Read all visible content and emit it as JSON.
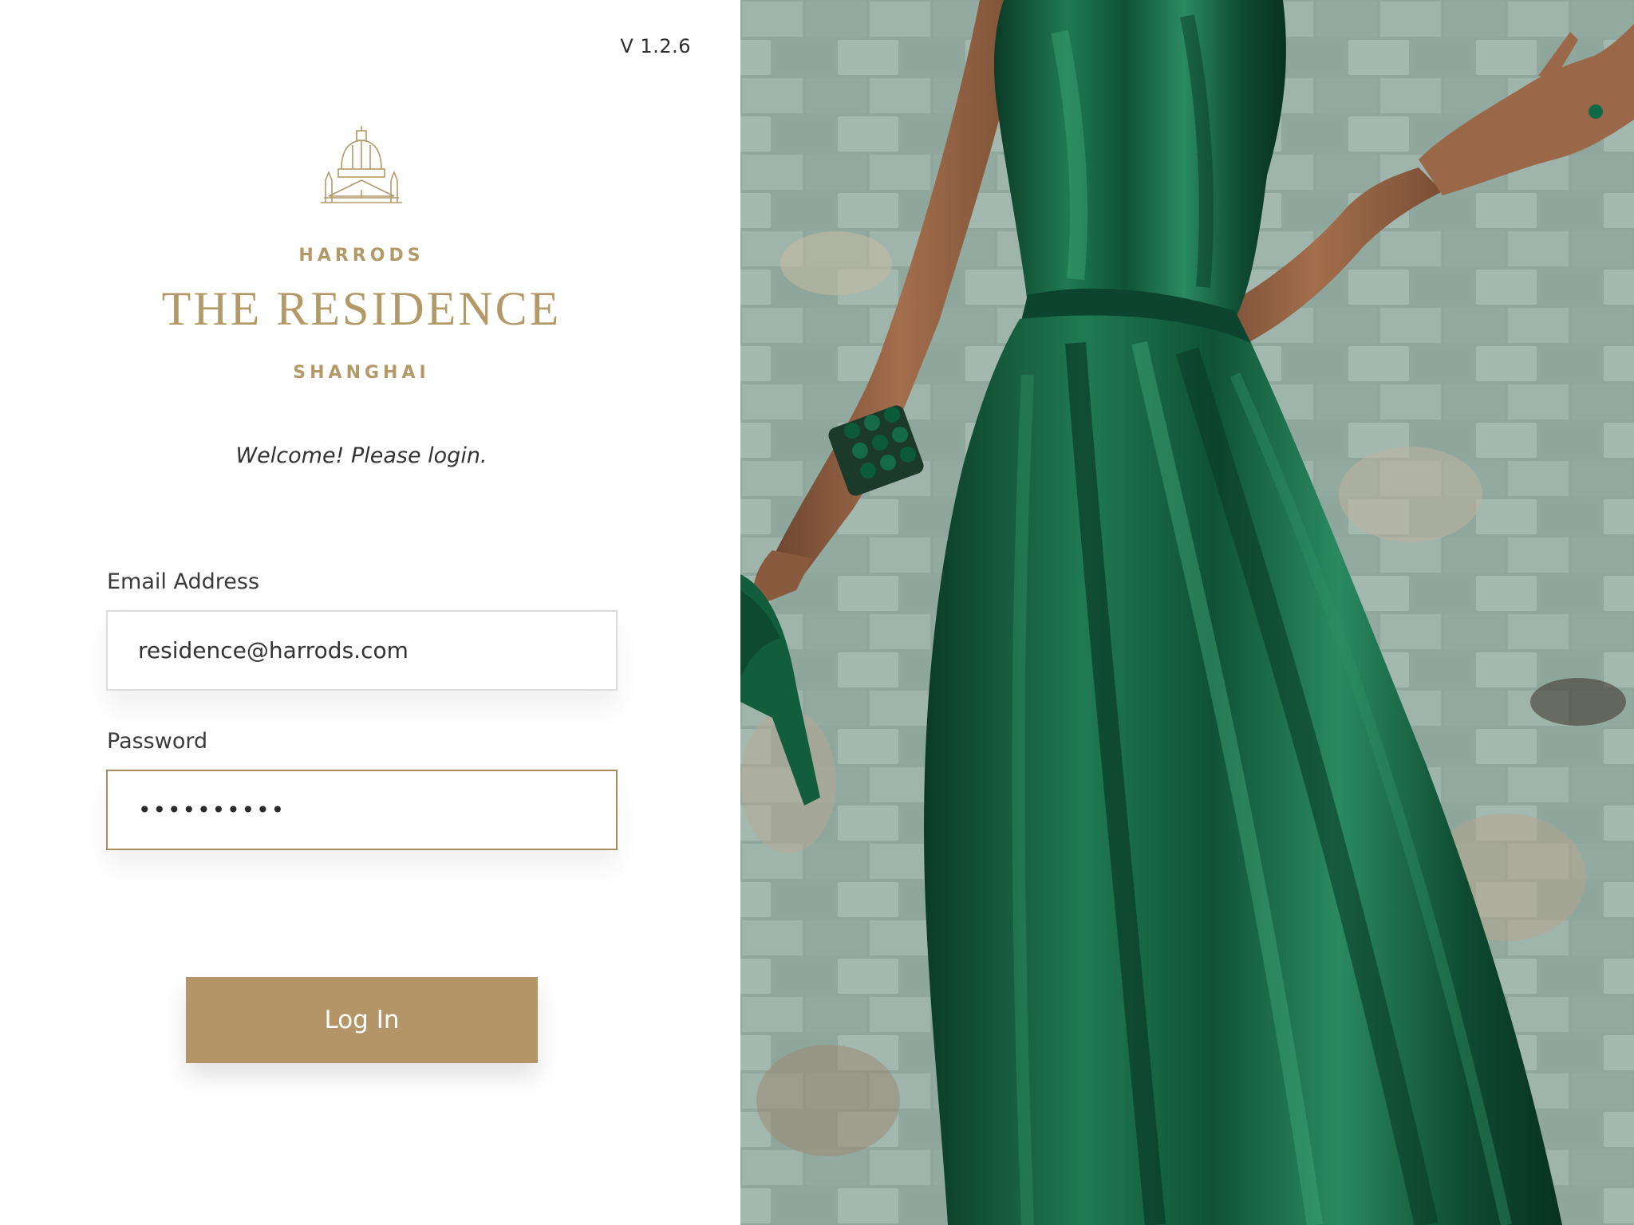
{
  "app": {
    "version": "V 1.2.6"
  },
  "branding": {
    "logo_icon": "dome-building-icon",
    "brand": "HARRODS",
    "title": "THE RESIDENCE",
    "city": "SHANGHAI",
    "accent_color": "#b39968"
  },
  "login": {
    "welcome": "Welcome! Please login.",
    "email_label": "Email Address",
    "email_value": "residence@harrods.com",
    "password_label": "Password",
    "password_masked": "••••••••••",
    "button_label": "Log In"
  },
  "photo": {
    "subject": "woman-in-green-satin-dress-image"
  }
}
